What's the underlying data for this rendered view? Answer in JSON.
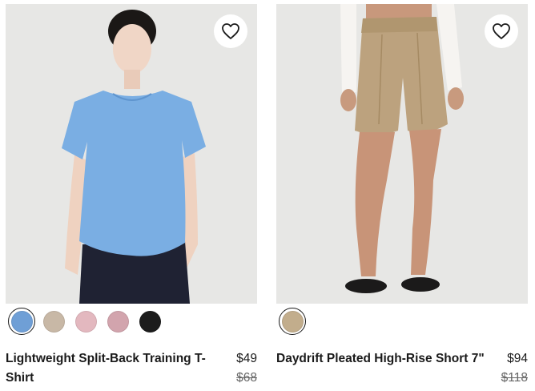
{
  "products": [
    {
      "name": "Lightweight Split-Back Training T-Shirt",
      "price": "$49",
      "original_price": "$68",
      "favorite_icon": "heart-outline-icon",
      "swatches": [
        {
          "color": "#6f9fd6",
          "selected": true
        },
        {
          "color": "#c8b8a6",
          "selected": false
        },
        {
          "color": "#e3b8bf",
          "selected": false
        },
        {
          "color": "#d2a4ad",
          "selected": false
        },
        {
          "color": "#1c1c1c",
          "selected": false
        }
      ]
    },
    {
      "name": "Daydrift Pleated High-Rise Short 7\"",
      "price": "$94",
      "original_price": "$118",
      "favorite_icon": "heart-outline-icon",
      "swatches": [
        {
          "color": "#c2ad8c",
          "selected": true
        }
      ]
    }
  ]
}
